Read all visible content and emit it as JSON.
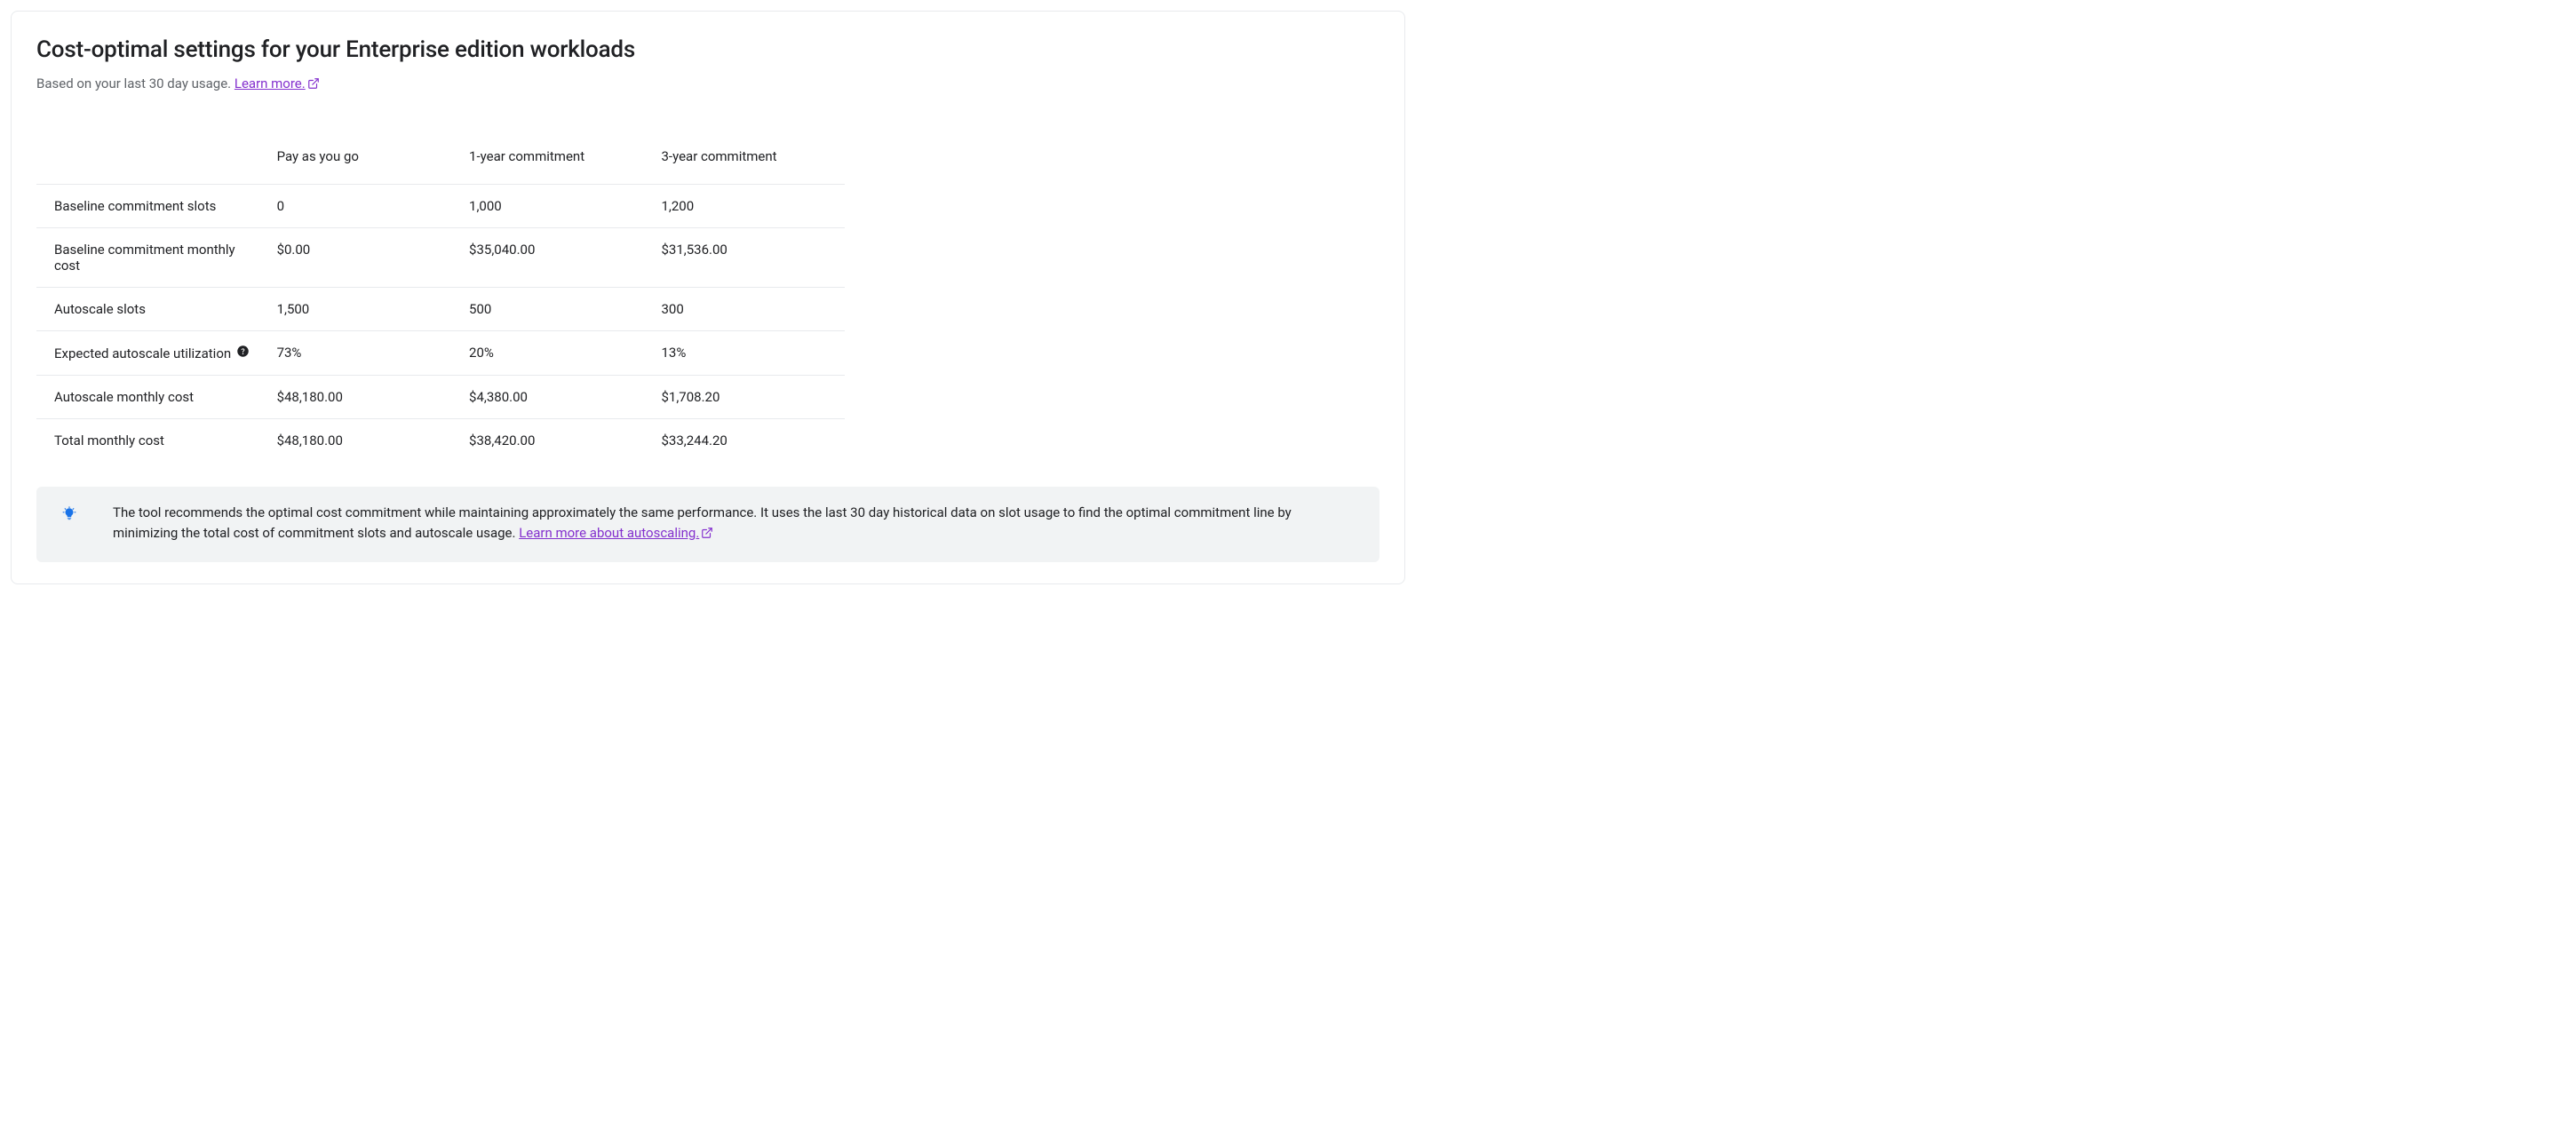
{
  "title": "Cost-optimal settings for your Enterprise edition workloads",
  "subtitle_prefix": "Based on your last 30 day usage. ",
  "subtitle_link": "Learn more.",
  "table": {
    "headers": {
      "col0": "",
      "col1": "Pay as you go",
      "col2": "1-year commitment",
      "col3": "3-year commitment"
    },
    "rows": [
      {
        "label": "Baseline commitment slots",
        "col1": "0",
        "col2": "1,000",
        "col3": "1,200",
        "help": false
      },
      {
        "label": "Baseline commitment monthly cost",
        "col1": "$0.00",
        "col2": "$35,040.00",
        "col3": "$31,536.00",
        "help": false
      },
      {
        "label": "Autoscale slots",
        "col1": "1,500",
        "col2": "500",
        "col3": "300",
        "help": false
      },
      {
        "label": "Expected autoscale utilization",
        "col1": "73%",
        "col2": "20%",
        "col3": "13%",
        "help": true
      },
      {
        "label": "Autoscale monthly cost",
        "col1": "$48,180.00",
        "col2": "$4,380.00",
        "col3": "$1,708.20",
        "help": false
      },
      {
        "label": "Total monthly cost",
        "col1": "$48,180.00",
        "col2": "$38,420.00",
        "col3": "$33,244.20",
        "help": false
      }
    ]
  },
  "info": {
    "text": "The tool recommends the optimal cost commitment while maintaining approximately the same performance. It uses the last 30 day historical data on slot usage to find the optimal commitment line by minimizing the total cost of commitment slots and autoscale usage. ",
    "link": "Learn more about autoscaling."
  }
}
